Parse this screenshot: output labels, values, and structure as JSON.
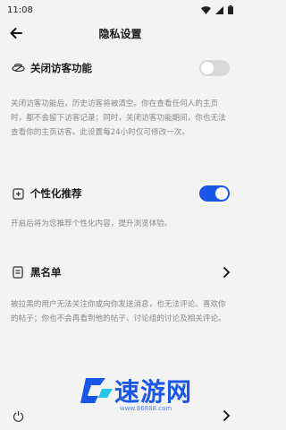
{
  "statusbar": {
    "time": "11:08"
  },
  "header": {
    "title": "隐私设置"
  },
  "visitor": {
    "label": "关闭访客功能",
    "toggle_on": false,
    "desc": "关闭访客功能后，历史访客将被清空。你在查看任何人的主页时，都不会留下访客记录；同时，关闭访客功能期间，你也无法查看你的主页访客。此设置每24小时仅可修改一次。"
  },
  "personal": {
    "label": "个性化推荐",
    "toggle_on": true,
    "desc": "开启后将为您推荐个性化内容，提升浏览体验。"
  },
  "blacklist": {
    "label": "黑名单",
    "desc": "被拉黑的用户无法关注你或向你发送消息，也无法评论、喜欢你的帖子；你也不会再看到他的帖子、讨论组的讨论及相关评论。"
  },
  "watermark": {
    "text": "速游网",
    "url": "www.86888.com"
  },
  "colors": {
    "accent": "#1a57e6",
    "background": "#f3f3f3"
  }
}
